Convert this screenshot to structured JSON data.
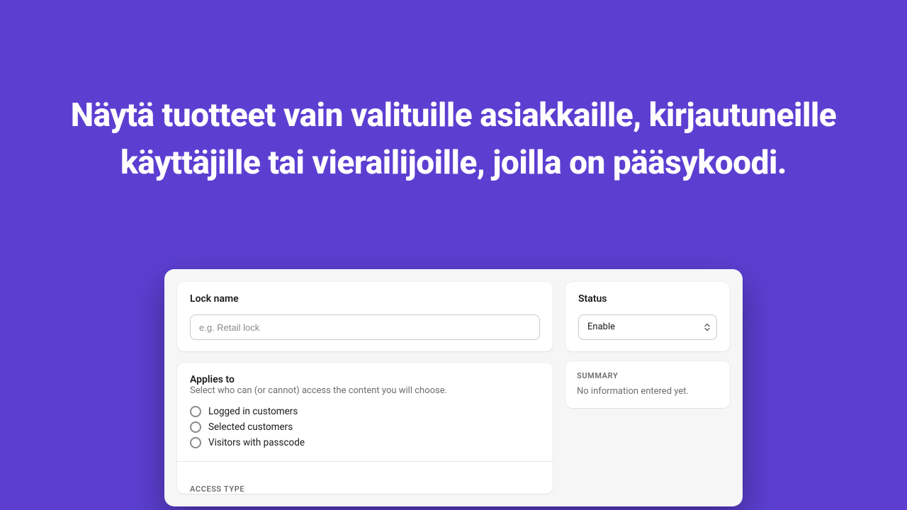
{
  "hero": {
    "text": "Näytä tuotteet vain valituille asiakkaille, kirjautuneille käyttäjille tai vierailijoille, joilla on pääsykoodi."
  },
  "lockName": {
    "title": "Lock name",
    "placeholder": "e.g. Retail lock"
  },
  "appliesTo": {
    "title": "Applies to",
    "helper": "Select who can (or cannot) access the content you will choose.",
    "options": [
      {
        "label": "Logged in customers"
      },
      {
        "label": "Selected customers"
      },
      {
        "label": "Visitors with passcode"
      }
    ],
    "accessTypeLabel": "ACCESS TYPE"
  },
  "status": {
    "title": "Status",
    "selected": "Enable"
  },
  "summary": {
    "label": "SUMMARY",
    "text": "No information entered yet."
  }
}
